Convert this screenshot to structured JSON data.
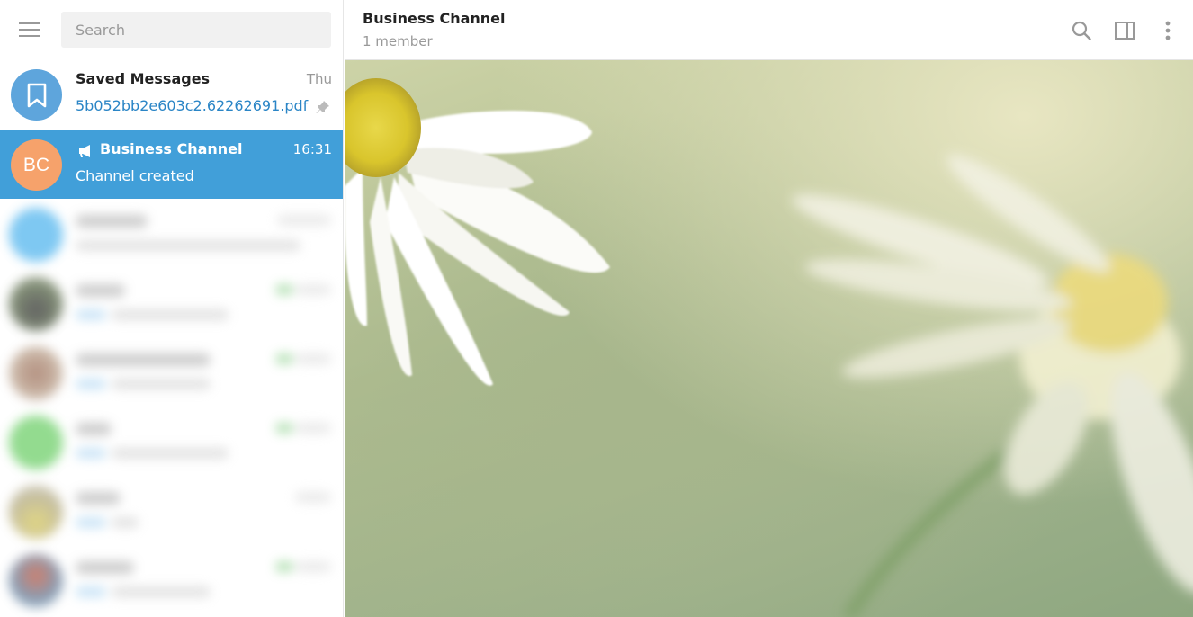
{
  "sidebar": {
    "search_placeholder": "Search",
    "chats": [
      {
        "name": "Saved Messages",
        "time": "Thu",
        "preview": "5b052bb2e603c2.62262691.pdf",
        "avatar_icon": "bookmark-icon",
        "pinned": true,
        "avatar_color": "#5ea5dc"
      },
      {
        "name": "Business Channel",
        "time": "16:31",
        "preview": "Channel created",
        "avatar_initials": "BC",
        "avatar_color": "#f6a26b",
        "type_icon": "megaphone-icon",
        "active": true
      }
    ]
  },
  "header": {
    "title": "Business Channel",
    "subtitle": "1 member",
    "icons": [
      "search-icon",
      "sidebar-toggle-icon",
      "more-vertical-icon"
    ]
  },
  "colors": {
    "accent": "#419fd9",
    "link": "#2a85c6"
  }
}
